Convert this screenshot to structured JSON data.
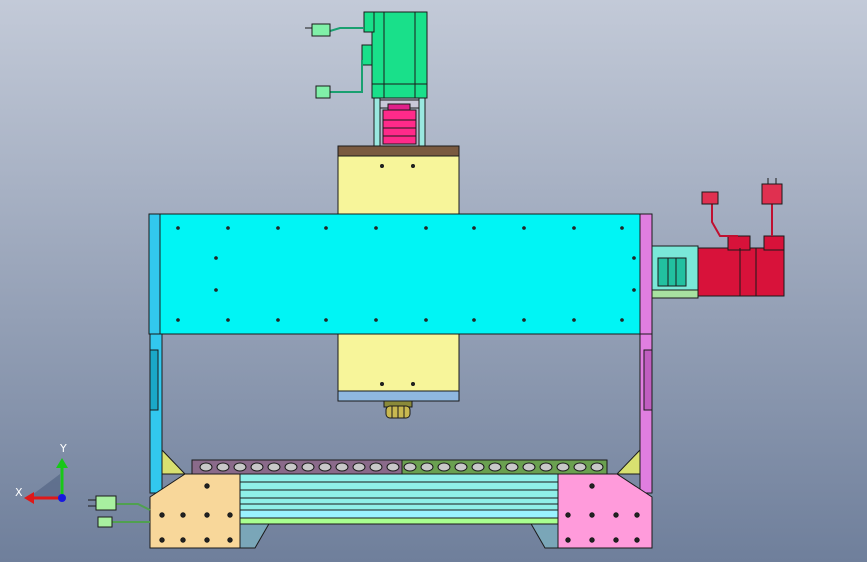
{
  "viewport": {
    "background_top": "#c3cad8",
    "background_bottom": "#6f7f9b"
  },
  "colors": {
    "gantry_beam": "#00f5f5",
    "head_block": "#f7f59a",
    "z_motor": "#19e08a",
    "x_motor": "#d8123a",
    "coupling": "#ff2a8a",
    "left_plate": "#f8d79a",
    "right_plate": "#ff9bdb",
    "left_column": "#32c8ee",
    "right_column": "#e07ee0",
    "rail": "#8fefe8",
    "cable_chain": "#8a6a8a",
    "cable_chain_green": "#6aa050",
    "outline": "#1a1a1a"
  },
  "triad": {
    "x_label": "X",
    "y_label": "Y",
    "x_color": "#e01818",
    "y_color": "#18c818",
    "z_color": "#1818e0"
  }
}
